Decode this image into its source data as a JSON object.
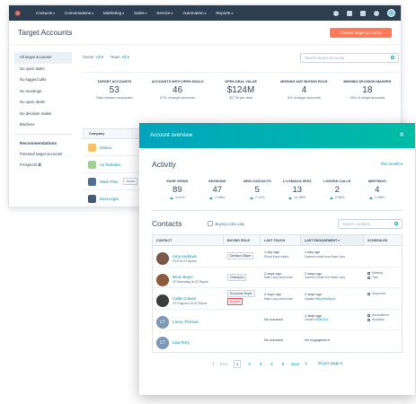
{
  "nav": {
    "items": [
      "Contacts",
      "Conversations",
      "Marketing",
      "Sales",
      "Service",
      "Automation",
      "Reports"
    ]
  },
  "page": {
    "title": "Target Accounts",
    "primary_button": "Choose target accounts"
  },
  "sidebar": {
    "items": [
      "All target accounts",
      "No open tasks",
      "No logged calls",
      "No meetings",
      "No open deals",
      "No decision maker",
      "Blockers"
    ],
    "recommendations_title": "Recommendations",
    "recommendations": [
      "Potential target accounts",
      "Prospects"
    ]
  },
  "filters": {
    "owner_label": "Owner:",
    "owner_value": "All",
    "team_label": "Team:",
    "team_value": "All",
    "search_placeholder": "Search target accounts"
  },
  "stats": [
    {
      "label": "Target Accounts",
      "value": "53",
      "sub": "Total chosen companies"
    },
    {
      "label": "Accounts with open deals",
      "value": "46",
      "sub": "87% of target accounts"
    },
    {
      "label": "Open deal value",
      "value": "$124M",
      "sub": "$2.7M per deal"
    },
    {
      "label": "Missing any buying role",
      "value": "4",
      "sub": "8% of target accounts"
    },
    {
      "label": "Missing decision makers",
      "value": "18",
      "sub": "26% of target accounts"
    }
  ],
  "companies": {
    "header": "Company",
    "rows": [
      {
        "name": "Evatco",
        "tag": "",
        "color": "#f5c26b"
      },
      {
        "name": "A2 Robotics",
        "tag": "",
        "color": "#a2d28f"
      },
      {
        "name": "Wash Plus",
        "tag": "Accou",
        "color": "#516f90"
      },
      {
        "name": "Boot Legal",
        "tag": "",
        "color": "#425b76"
      }
    ]
  },
  "modal": {
    "title": "Account overview",
    "activity_title": "Activity",
    "period": "This month",
    "activity": [
      {
        "label": "Page views",
        "value": "89",
        "delta": "3.01%"
      },
      {
        "label": "Sessions",
        "value": "47",
        "delta": "2.98%"
      },
      {
        "label": "New contacts",
        "value": "5",
        "delta": "7.12%"
      },
      {
        "label": "1:1 emails sent",
        "value": "13",
        "delta": "13.45%"
      },
      {
        "label": "Logged calls",
        "value": "2",
        "delta": "2.98%"
      },
      {
        "label": "Meetings",
        "value": "4",
        "delta": "2.98%"
      }
    ],
    "contacts_title": "Contacts",
    "buying_roles_only": "Buying roles only",
    "search_placeholder": "Search contacts",
    "columns": [
      "Contact",
      "Buying role",
      "Last touch",
      "Last engagement",
      "Scheduled"
    ],
    "rows": [
      {
        "name": "Amy Andrews",
        "title": "CEO at S2 Biqnte",
        "initials": "",
        "avatar_color": "#7c5a4b",
        "roles": [
          "Decision Maker"
        ],
        "blocker": "",
        "touch1": "1 day ago",
        "touch2": "Ethan Kaye called",
        "eng1": "1 day ago",
        "eng2": "Opened email from Nate Lacy",
        "eng_link": "",
        "sched": []
      },
      {
        "name": "Brian Boyer",
        "title": "VP Marketing at S2 Biqnte",
        "initials": "",
        "avatar_color": "#8d5a3c",
        "roles": [
          "Champion"
        ],
        "blocker": "",
        "touch1": "2 days ago",
        "touch2": "Nate Lacy sent email",
        "eng1": "2 days ago",
        "eng2": "Opened email from Nate Lacy",
        "eng_link": "",
        "sched": [
          "Meeting",
          "Task"
        ]
      },
      {
        "name": "Callie Craven",
        "title": "VP Engineer at S2 Biqnte",
        "initials": "",
        "avatar_color": "#3c3c3c",
        "roles": [
          "Economic Buyer"
        ],
        "blocker": "Blocker",
        "touch1": "2 days ago",
        "touch2": "Nate Lacy sent email",
        "eng1": "2 days ago",
        "eng2": "Viewed ",
        "eng_link": "Why HubSpot?",
        "sched": [
          "Sequence"
        ]
      },
      {
        "name": "Lacey Thomas",
        "title": "",
        "initials": "LT",
        "avatar_color": "#7c98b6",
        "roles": [],
        "blocker": "",
        "touch1": "No outreach",
        "touch2": "",
        "eng1": "2 days ago",
        "eng2": "Viewed ",
        "eng_link": "RBM 101",
        "sched": [
          "Ad audience",
          "Workflow"
        ]
      },
      {
        "name": "Lisa Terry",
        "title": "",
        "initials": "LT",
        "avatar_color": "#7c98b6",
        "roles": [],
        "blocker": "",
        "touch1": "No outreach",
        "touch2": "",
        "eng1": "No engagement",
        "eng2": "",
        "eng_link": "",
        "sched": []
      }
    ],
    "pager": {
      "prev": "Prev",
      "pages": [
        "1",
        "2",
        "3",
        "4",
        "5"
      ],
      "next": "Next",
      "per_page": "25 per page"
    }
  }
}
